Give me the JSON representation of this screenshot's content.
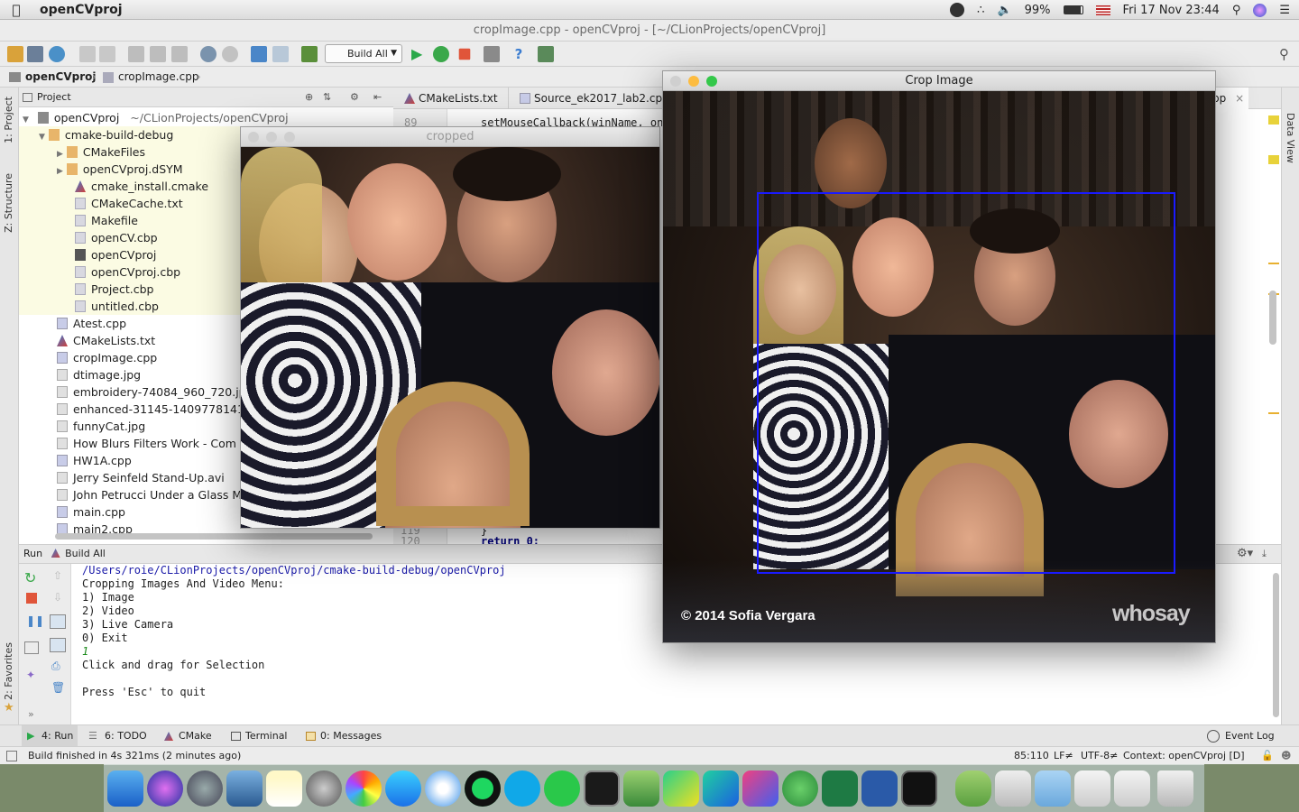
{
  "menubar": {
    "app_name": "openCVproj",
    "battery": "99%",
    "datetime": "Fri 17 Nov  23:44"
  },
  "window_title": "cropImage.cpp - openCVproj - [~/CLionProjects/openCVproj]",
  "toolbar": {
    "build_config": "Build All"
  },
  "breadcrumb": {
    "project": "openCVproj",
    "file": "cropImage.cpp"
  },
  "side_tabs": {
    "project": "1: Project",
    "structure": "Z: Structure",
    "favorites": "2: Favorites",
    "data_view": "Data View"
  },
  "project_panel": {
    "title": "Project",
    "root": "openCVproj",
    "root_path": "~/CLionProjects/openCVproj",
    "items": [
      {
        "label": "cmake-build-debug"
      },
      {
        "label": "CMakeFiles"
      },
      {
        "label": "openCVproj.dSYM"
      },
      {
        "label": "cmake_install.cmake"
      },
      {
        "label": "CMakeCache.txt"
      },
      {
        "label": "Makefile"
      },
      {
        "label": "openCV.cbp"
      },
      {
        "label": "openCVproj"
      },
      {
        "label": "openCVproj.cbp"
      },
      {
        "label": "Project.cbp"
      },
      {
        "label": "untitled.cbp"
      },
      {
        "label": "Atest.cpp"
      },
      {
        "label": "CMakeLists.txt"
      },
      {
        "label": "cropImage.cpp"
      },
      {
        "label": "dtimage.jpg"
      },
      {
        "label": "embroidery-74084_960_720.jp"
      },
      {
        "label": "enhanced-31145-1409778141-"
      },
      {
        "label": "funnyCat.jpg"
      },
      {
        "label": "How Blurs  Filters Work - Com"
      },
      {
        "label": "HW1A.cpp"
      },
      {
        "label": "Jerry Seinfeld Stand-Up.avi"
      },
      {
        "label": "John Petrucci Under a Glass M"
      },
      {
        "label": "main.cpp"
      },
      {
        "label": "main2.cpp"
      }
    ]
  },
  "editor": {
    "tabs": [
      "CMakeLists.txt",
      "Source_ek2017_lab2.cpp",
      "pp"
    ],
    "line_89": "89",
    "line_89_code": "setMouseCallback(winName, onM",
    "line_119": "119",
    "line_119_code": "}",
    "line_120": "120",
    "line_120_code": "return 0;"
  },
  "run_panel": {
    "run_label": "Run",
    "config": "Build All",
    "console": [
      "/Users/roie/CLionProjects/openCVproj/cmake-build-debug/openCVproj",
      "Cropping Images And Video Menu:",
      "1) Image",
      "2) Video",
      "3) Live Camera",
      "0) Exit",
      "1",
      "Click and drag for Selection",
      "",
      "Press 'Esc' to quit"
    ]
  },
  "bottom_tabs": {
    "run": "4: Run",
    "todo": "6: TODO",
    "cmake": "CMake",
    "terminal": "Terminal",
    "messages": "0: Messages",
    "event_log": "Event Log"
  },
  "status": {
    "message": "Build finished in 4s 321ms (2 minutes ago)",
    "position": "85:110",
    "line_sep": "LF≠",
    "encoding": "UTF-8≠",
    "context": "Context: openCVproj [D]"
  },
  "cropped_window": {
    "title": "cropped"
  },
  "crop_window": {
    "title": "Crop Image",
    "copyright": "© 2014 Sofia Vergara",
    "watermark": "whosay"
  },
  "colors": {
    "selection_rect": "#1a1aff",
    "traffic_red": "#fc605c",
    "traffic_yellow": "#fdbc40",
    "traffic_green": "#34c84a"
  }
}
